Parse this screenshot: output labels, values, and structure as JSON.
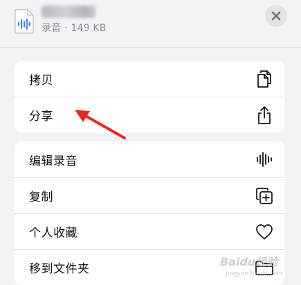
{
  "header": {
    "file_meta": "录音 · 149 KB",
    "icons": {
      "file": "audio-file-icon",
      "close": "close-icon"
    }
  },
  "menu": {
    "group1": [
      {
        "label": "拷贝",
        "icon": "copy-icon"
      },
      {
        "label": "分享",
        "icon": "share-icon"
      }
    ],
    "group2": [
      {
        "label": "编辑录音",
        "icon": "waveform-icon"
      },
      {
        "label": "复制",
        "icon": "duplicate-icon"
      },
      {
        "label": "个人收藏",
        "icon": "heart-icon"
      },
      {
        "label": "移到文件夹",
        "icon": "folder-icon"
      }
    ]
  },
  "annotation": {
    "icon": "red-arrow-icon",
    "color": "#e8262a"
  },
  "watermark": {
    "main": "Baidu经验",
    "sub": "jingyan.baidu.com"
  },
  "colors": {
    "background": "#f2f2f7",
    "card": "#ffffff",
    "waveform_blue": "#3b82f6",
    "arrow_red": "#e8262a"
  }
}
